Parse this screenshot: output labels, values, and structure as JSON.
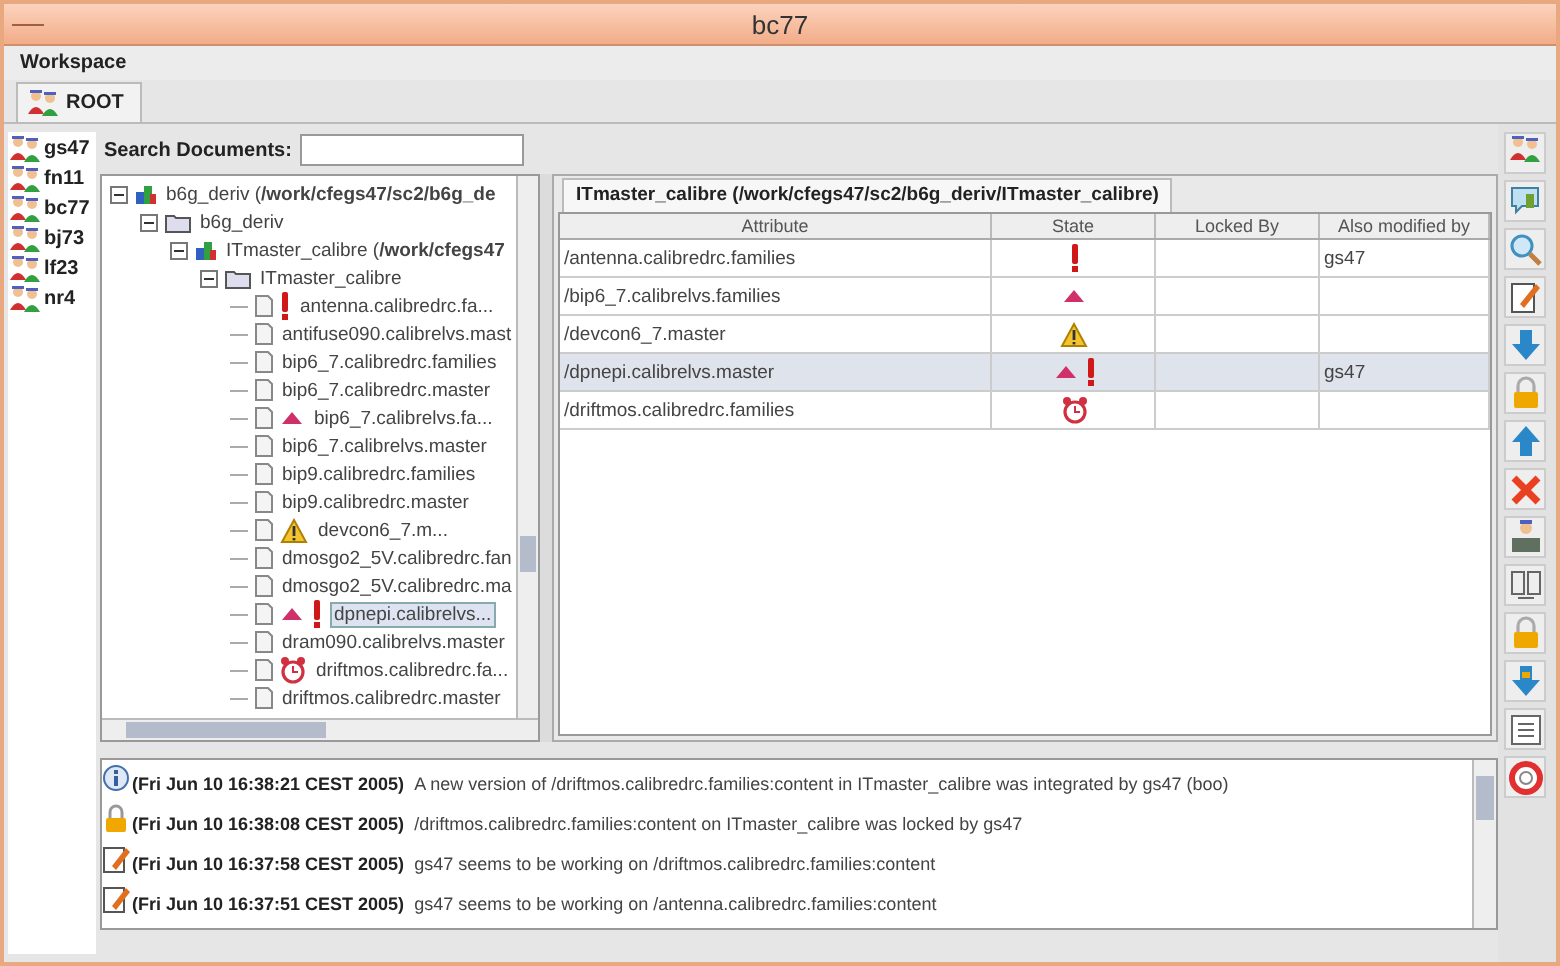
{
  "window": {
    "title": "bc77"
  },
  "menu": [
    "Workspace"
  ],
  "workspace_tabs": [
    {
      "label": "ROOT",
      "selected": true
    }
  ],
  "users": [
    "gs47",
    "fn11",
    "bc77",
    "bj73",
    "lf23",
    "nr4"
  ],
  "search": {
    "label": "Search Documents:"
  },
  "tree": [
    {
      "kind": "project",
      "label": "b6g_deriv (**/work/cfegs47/sc2/b6g_de**",
      "expanded": true,
      "children": [
        {
          "kind": "folder",
          "label": "b6g_deriv",
          "expanded": true,
          "children": [
            {
              "kind": "project",
              "label": "ITmaster_calibre (**/work/cfegs47**",
              "expanded": true,
              "children": [
                {
                  "kind": "folder",
                  "label": "ITmaster_calibre",
                  "expanded": true,
                  "children": [
                    {
                      "kind": "file",
                      "label": "antenna.calibredrc.fa...",
                      "icons": [
                        {
                          "kind": "conflict"
                        }
                      ],
                      "selected": false
                    },
                    {
                      "kind": "file",
                      "label": "antifuse090.calibrelvs.mast",
                      "selected": false
                    },
                    {
                      "kind": "file",
                      "label": "bip6_7.calibredrc.families",
                      "selected": false
                    },
                    {
                      "kind": "file",
                      "label": "bip6_7.calibredrc.master",
                      "selected": false
                    },
                    {
                      "kind": "file",
                      "label": "bip6_7.calibrelvs.fa...",
                      "icons": [
                        {
                          "kind": "modified"
                        }
                      ],
                      "selected": false
                    },
                    {
                      "kind": "file",
                      "label": "bip6_7.calibrelvs.master",
                      "selected": false
                    },
                    {
                      "kind": "file",
                      "label": "bip9.calibredrc.families",
                      "selected": false
                    },
                    {
                      "kind": "file",
                      "label": "bip9.calibredrc.master",
                      "selected": false
                    },
                    {
                      "kind": "file",
                      "label": "devcon6_7.m...",
                      "icons": [
                        {
                          "kind": "warning"
                        }
                      ],
                      "selected": false
                    },
                    {
                      "kind": "file",
                      "label": "dmosgo2_5V.calibredrc.fan",
                      "selected": false
                    },
                    {
                      "kind": "file",
                      "label": "dmosgo2_5V.calibredrc.ma",
                      "selected": false
                    },
                    {
                      "kind": "file",
                      "label": "dpnepi.calibrelvs...",
                      "icons": [
                        {
                          "kind": "modified"
                        },
                        {
                          "kind": "conflict"
                        }
                      ],
                      "selected": true
                    },
                    {
                      "kind": "file",
                      "label": "dram090.calibrelvs.master",
                      "selected": false
                    },
                    {
                      "kind": "file",
                      "label": "driftmos.calibredrc.fa...",
                      "icons": [
                        {
                          "kind": "alarm"
                        }
                      ],
                      "selected": false
                    },
                    {
                      "kind": "file",
                      "label": "driftmos.calibredrc.master",
                      "selected": false
                    }
                  ]
                }
              ]
            }
          ]
        }
      ]
    }
  ],
  "document_tabs": [
    {
      "label": "ITmaster_calibre (/work/cfegs47/sc2/b6g_deriv/ITmaster_calibre)",
      "selected": true
    }
  ],
  "table": {
    "columns": [
      "Attribute",
      "State",
      "Locked By",
      "Also modified by"
    ],
    "rows": [
      {
        "attribute": "/antenna.calibredrc.families",
        "icons": [
          {
            "kind": "conflict"
          }
        ],
        "also_modified_by": "gs47",
        "selected": false
      },
      {
        "attribute": "/bip6_7.calibrelvs.families",
        "icons": [
          {
            "kind": "modified"
          }
        ],
        "selected": false
      },
      {
        "attribute": "/devcon6_7.master",
        "icons": [
          {
            "kind": "warning"
          }
        ],
        "selected": false
      },
      {
        "attribute": "/dpnepi.calibrelvs.master",
        "icons": [
          {
            "kind": "modified"
          },
          {
            "kind": "conflict"
          }
        ],
        "also_modified_by": "gs47",
        "selected": true
      },
      {
        "attribute": "/driftmos.calibredrc.families",
        "icons": [
          {
            "kind": "alarm"
          }
        ],
        "selected": false
      }
    ]
  },
  "log": [
    {
      "kind": "integrated",
      "time": "(Fri Jun 10 16:38:21 CEST 2005)",
      "message": "A new version of /driftmos.calibredrc.families:content in ITmaster_calibre was integrated by gs47 (boo)"
    },
    {
      "kind": "locked",
      "time": "(Fri Jun 10 16:38:08 CEST 2005)",
      "message": "/driftmos.calibredrc.families:content on ITmaster_calibre was locked by gs47"
    },
    {
      "kind": "editing",
      "time": "(Fri Jun 10 16:37:58 CEST 2005)",
      "message": "gs47 seems to be working on /driftmos.calibredrc.families:content"
    },
    {
      "kind": "editing",
      "time": "(Fri Jun 10 16:37:51 CEST 2005)",
      "message": "gs47 seems to be working on /antenna.calibredrc.families:content"
    }
  ]
}
